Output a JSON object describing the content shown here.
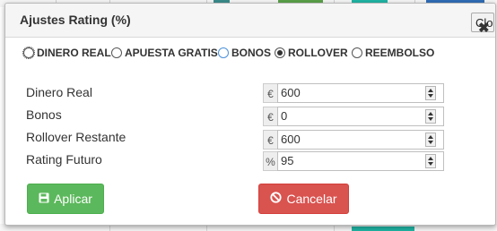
{
  "modal": {
    "title": "Ajustes Rating (%)",
    "close_label": "Close"
  },
  "options": [
    {
      "label": "DINERO REAL",
      "checked": false
    },
    {
      "label": "APUESTA GRATIS",
      "checked": false
    },
    {
      "label": "BONOS",
      "checked": false
    },
    {
      "label": "ROLLOVER",
      "checked": true
    },
    {
      "label": "REEMBOLSO",
      "checked": false
    }
  ],
  "fields": [
    {
      "label": "Dinero Real",
      "unit": "€",
      "value": "600"
    },
    {
      "label": "Bonos",
      "unit": "€",
      "value": "0"
    },
    {
      "label": "Rollover Restante",
      "unit": "€",
      "value": "600"
    },
    {
      "label": "Rating Futuro",
      "unit": "%",
      "value": "95"
    }
  ],
  "buttons": {
    "apply_label": "Aplicar",
    "cancel_label": "Cancelar"
  },
  "colors": {
    "apply": "#5cb85c",
    "cancel": "#d9534f",
    "header": "#f5f5f5"
  },
  "icons": {
    "apply": "save-icon",
    "cancel": "ban-icon"
  }
}
